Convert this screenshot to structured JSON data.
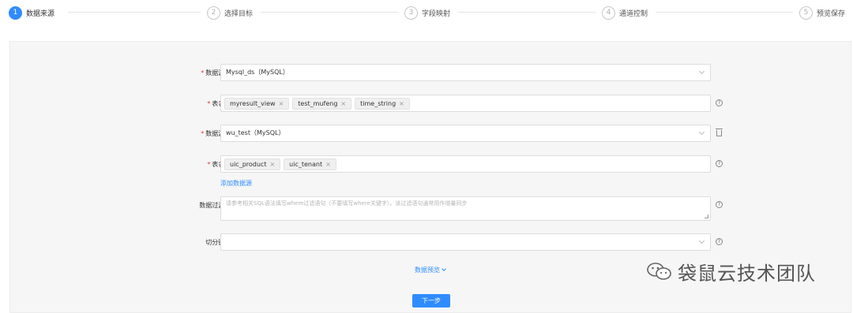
{
  "steps": [
    {
      "num": "1",
      "label": "数据来源",
      "active": true
    },
    {
      "num": "2",
      "label": "选择目标"
    },
    {
      "num": "3",
      "label": "字段映射"
    },
    {
      "num": "4",
      "label": "通道控制"
    },
    {
      "num": "5",
      "label": "预览保存"
    }
  ],
  "form": {
    "required_mark": "*",
    "source1": {
      "label": "数据源:",
      "value": "Mysql_ds（MySQL）"
    },
    "table1": {
      "label": "表名:",
      "tags": [
        "myresult_view",
        "test_mufeng",
        "time_string"
      ]
    },
    "source2": {
      "label": "数据源:",
      "value": "wu_test（MySQL）"
    },
    "table2": {
      "label": "表名:",
      "tags": [
        "uic_product",
        "uic_tenant"
      ]
    },
    "add_source_link": "添加数据源",
    "filter": {
      "label": "数据过滤:",
      "placeholder": "请参考相关SQL语法填写where过滤语句（不要填写where关键字）。该过滤语句通常用作增量同步"
    },
    "split_key": {
      "label": "切分键:",
      "value": ""
    },
    "preview_link": "数据预览",
    "next_button": "下一步",
    "tag_close": "×",
    "help_glyph": "?"
  },
  "watermark": {
    "text": "袋鼠云技术团队"
  }
}
